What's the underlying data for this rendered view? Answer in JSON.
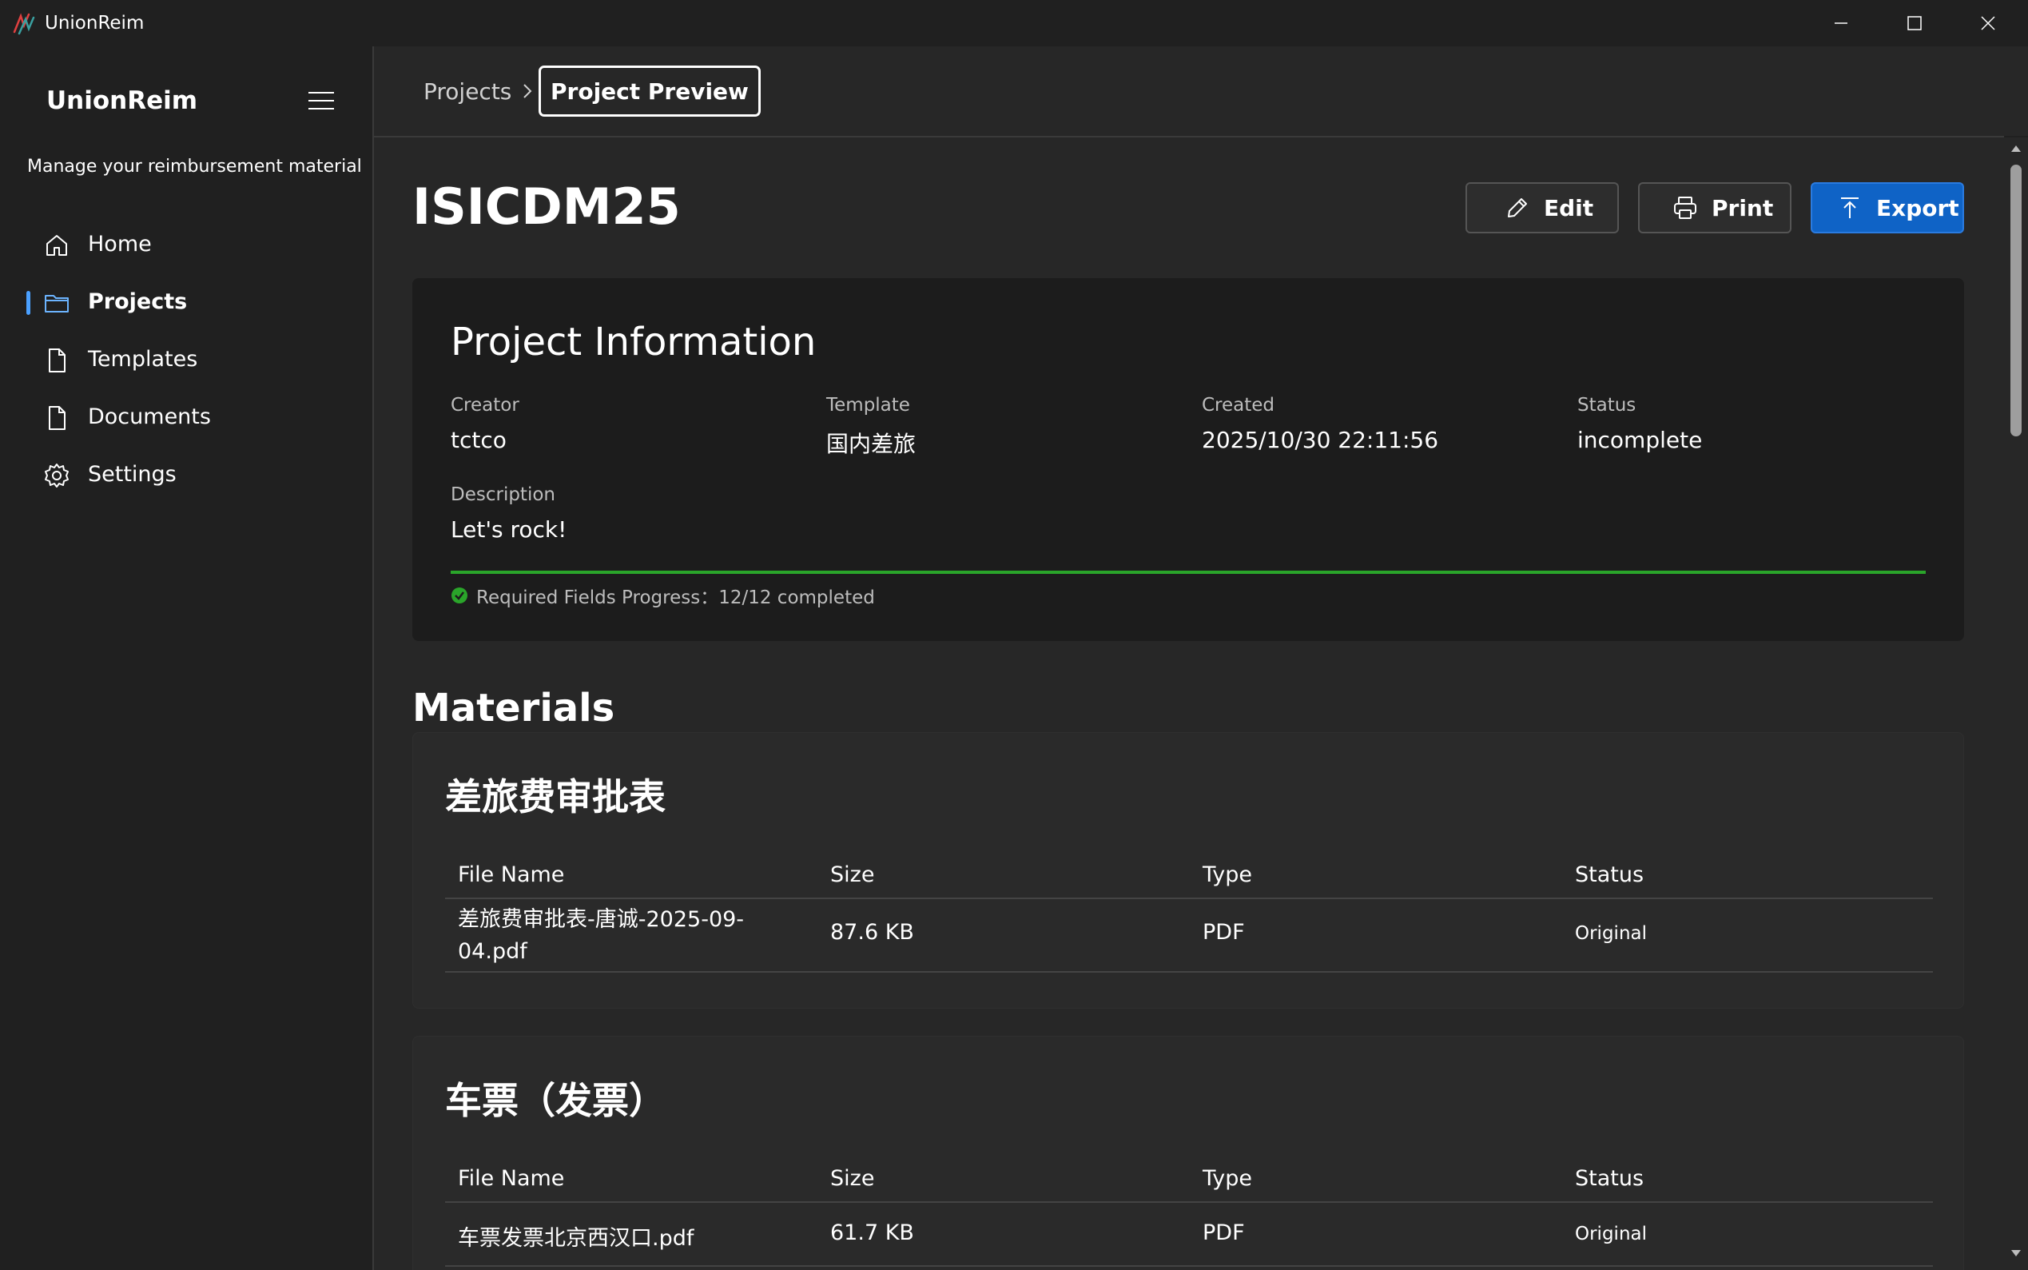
{
  "window": {
    "app_title": "UnionReim",
    "accent": "#4aa0ff"
  },
  "sidebar": {
    "brand": "UnionReim",
    "subtitle": "Manage your reimbursement material",
    "items": [
      {
        "label": "Home",
        "icon": "home-icon"
      },
      {
        "label": "Projects",
        "icon": "folder-icon",
        "active": true
      },
      {
        "label": "Templates",
        "icon": "document-icon"
      },
      {
        "label": "Documents",
        "icon": "document-icon"
      },
      {
        "label": "Settings",
        "icon": "gear-icon"
      }
    ]
  },
  "breadcrumb": {
    "parent": "Projects",
    "current": "Project Preview"
  },
  "page": {
    "title": "ISICDM25",
    "actions": {
      "edit": "Edit",
      "print": "Print",
      "export": "Export"
    }
  },
  "project_info": {
    "title": "Project Information",
    "creator_label": "Creator",
    "creator": "tctco",
    "template_label": "Template",
    "template": "国内差旅",
    "created_label": "Created",
    "created": "2025/10/30 22:11:56",
    "status_label": "Status",
    "status": "incomplete",
    "description_label": "Description",
    "description": "Let's rock!",
    "progress_text": "Required Fields Progress：12/12 completed",
    "progress_fraction": 1.0,
    "progress_color": "#2aa52a"
  },
  "materials": {
    "title": "Materials",
    "columns": [
      "File Name",
      "Size",
      "Type",
      "Status"
    ],
    "groups": [
      {
        "title": "差旅费审批表",
        "rows": [
          {
            "file_name": "差旅费审批表-唐诚-2025-09-04.pdf",
            "size": "87.6 KB",
            "type": "PDF",
            "status": "Original"
          }
        ]
      },
      {
        "title": "车票（发票）",
        "rows": [
          {
            "file_name": "车票发票北京西汉口.pdf",
            "size": "61.7 KB",
            "type": "PDF",
            "status": "Original"
          }
        ]
      }
    ]
  }
}
